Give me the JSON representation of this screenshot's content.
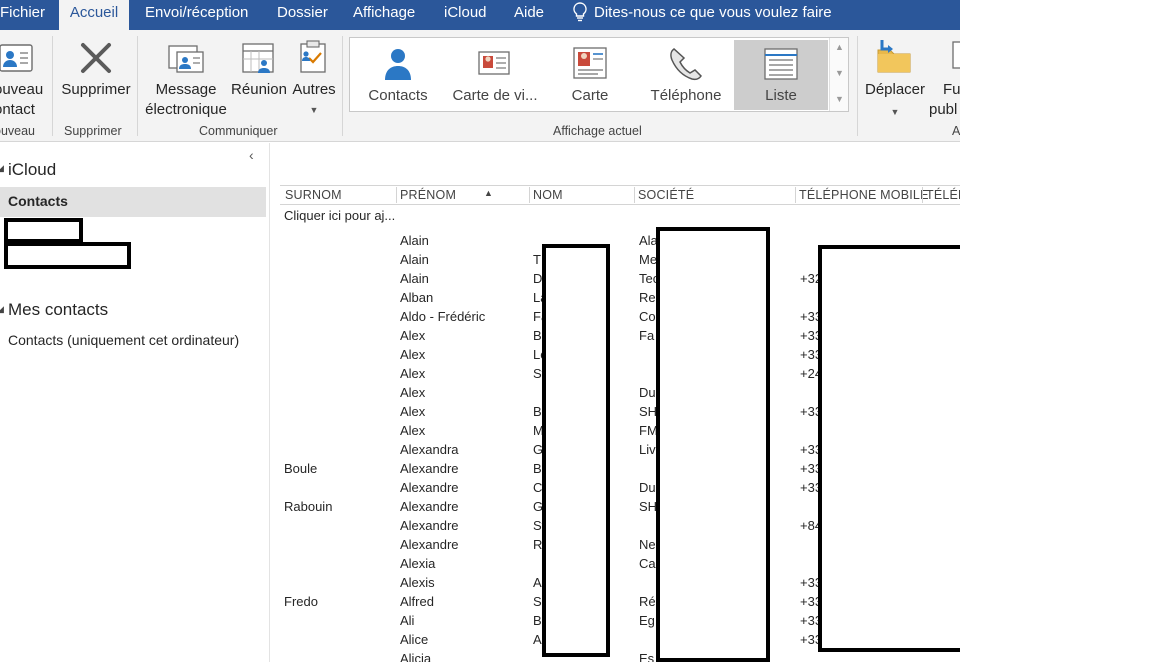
{
  "menu": {
    "tabs": [
      {
        "label": "Fichier"
      },
      {
        "label": "Accueil"
      },
      {
        "label": "Envoi/réception"
      },
      {
        "label": "Dossier"
      },
      {
        "label": "Affichage"
      },
      {
        "label": "iCloud"
      },
      {
        "label": "Aide"
      }
    ],
    "tell_me": "Dites-nous ce que vous voulez faire"
  },
  "ribbon": {
    "new_contact": {
      "line1": "ouveau",
      "line2": "ontact"
    },
    "group_new": "ouveau",
    "delete": {
      "label": "Supprimer"
    },
    "group_delete": "Supprimer",
    "message": {
      "line1": "Message",
      "line2": "électronique"
    },
    "meeting": {
      "label": "Réunion"
    },
    "more": {
      "label": "Autres"
    },
    "group_communicate": "Communiquer",
    "views": [
      {
        "label": "Contacts"
      },
      {
        "label": "Carte de vi..."
      },
      {
        "label": "Carte"
      },
      {
        "label": "Téléphone"
      },
      {
        "label": "Liste"
      }
    ],
    "group_current_view": "Affichage actuel",
    "move": {
      "label": "Déplacer"
    },
    "fuse": {
      "line1": "Fu",
      "line2": "publ"
    },
    "group_tail": "A"
  },
  "nav": {
    "icloud": "iCloud",
    "contacts": "Contacts",
    "my_contacts": "Mes contacts",
    "local_contacts": "Contacts (uniquement cet ordinateur)"
  },
  "list": {
    "columns": {
      "surnom": "SURNOM",
      "prenom": "PRÉNOM",
      "nom": "NOM",
      "societe": "SOCIÉTÉ",
      "tel_mobile": "TÉLÉPHONE MOBILE",
      "tel_extra": "TÉLÉP"
    },
    "add_row": "Cliquer ici pour aj...",
    "rows": [
      {
        "surnom": "",
        "prenom": "Alain",
        "nom": "",
        "societe": "Ala",
        "tel": ""
      },
      {
        "surnom": "",
        "prenom": "Alain",
        "nom": "T",
        "societe": "Me",
        "tel": ""
      },
      {
        "surnom": "",
        "prenom": "Alain",
        "nom": "D",
        "societe": "Tec",
        "tel": "+32"
      },
      {
        "surnom": "",
        "prenom": "Alban",
        "nom": "La",
        "societe": "Rec",
        "tel": ""
      },
      {
        "surnom": "",
        "prenom": "Aldo - Frédéric",
        "nom": "Fa",
        "societe": "Co",
        "tel": "+33"
      },
      {
        "surnom": "",
        "prenom": "Alex",
        "nom": "B",
        "societe": "Fa",
        "tel": "+33"
      },
      {
        "surnom": "",
        "prenom": "Alex",
        "nom": "Le",
        "societe": "",
        "tel": "+33"
      },
      {
        "surnom": "",
        "prenom": "Alex",
        "nom": "St",
        "societe": "",
        "tel": "+24"
      },
      {
        "surnom": "",
        "prenom": "Alex",
        "nom": "",
        "societe": "Du",
        "tel": ""
      },
      {
        "surnom": "",
        "prenom": "Alex",
        "nom": "Bo",
        "societe": "SH",
        "tel": "+33"
      },
      {
        "surnom": "",
        "prenom": "Alex",
        "nom": "M",
        "societe": "FM",
        "tel": ""
      },
      {
        "surnom": "",
        "prenom": "Alexandra",
        "nom": "G",
        "societe": "Liv",
        "tel": "+33"
      },
      {
        "surnom": "Boule",
        "prenom": "Alexandre",
        "nom": "Bo",
        "societe": "",
        "tel": "+33"
      },
      {
        "surnom": "",
        "prenom": "Alexandre",
        "nom": "C",
        "societe": "Du",
        "tel": "+33"
      },
      {
        "surnom": "Rabouin",
        "prenom": "Alexandre",
        "nom": "G",
        "societe": "SH",
        "tel": ""
      },
      {
        "surnom": "",
        "prenom": "Alexandre",
        "nom": "St",
        "societe": "",
        "tel": "+84"
      },
      {
        "surnom": "",
        "prenom": "Alexandre",
        "nom": "R",
        "societe": "Ne",
        "tel": ""
      },
      {
        "surnom": "",
        "prenom": "Alexia",
        "nom": "",
        "societe": "Ca",
        "tel": ""
      },
      {
        "surnom": "",
        "prenom": "Alexis",
        "nom": "A",
        "societe": "",
        "tel": "+33"
      },
      {
        "surnom": "Fredo",
        "prenom": "Alfred",
        "nom": "Sa",
        "societe": "Ré",
        "tel": "+33"
      },
      {
        "surnom": "",
        "prenom": "Ali",
        "nom": "Be",
        "societe": "Eg",
        "tel": "+33"
      },
      {
        "surnom": "",
        "prenom": "Alice",
        "nom": "A",
        "societe": "",
        "tel": "+33"
      },
      {
        "surnom": "",
        "prenom": "Alicia",
        "nom": "",
        "societe": "Es",
        "tel": ""
      }
    ]
  },
  "colors": {
    "brand": "#2b579a",
    "ribbon_bg": "#f3f3f3",
    "selected_nav": "#e1e1e1",
    "selected_view": "#cdcdcd"
  }
}
